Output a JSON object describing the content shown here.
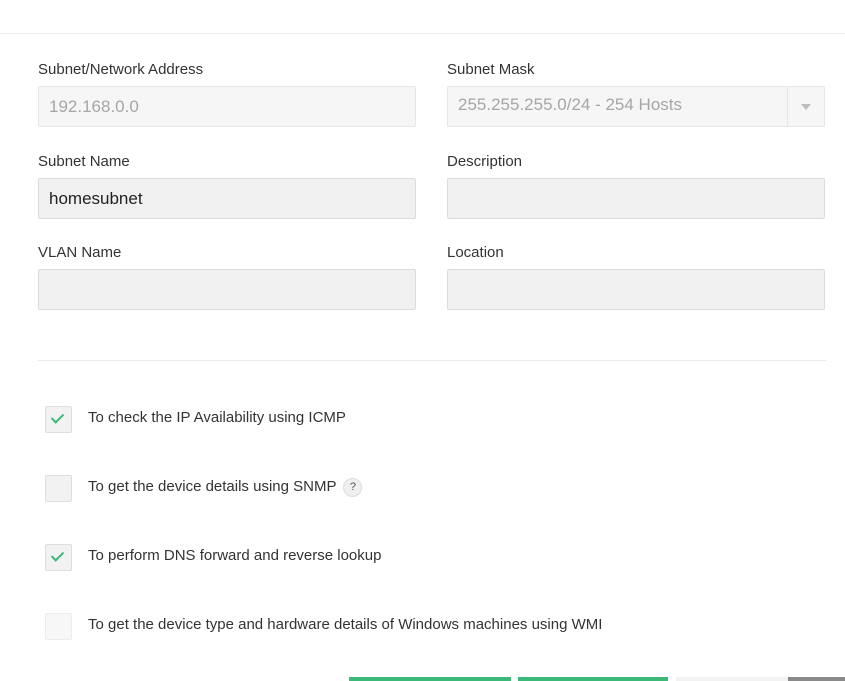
{
  "form": {
    "subnet_address": {
      "label": "Subnet/Network Address",
      "value": "192.168.0.0"
    },
    "subnet_mask": {
      "label": "Subnet Mask",
      "value": "255.255.255.0/24 - 254 Hosts"
    },
    "subnet_name": {
      "label": "Subnet Name",
      "value": "homesubnet"
    },
    "description": {
      "label": "Description",
      "value": ""
    },
    "vlan_name": {
      "label": "VLAN Name",
      "value": ""
    },
    "location": {
      "label": "Location",
      "value": ""
    }
  },
  "options": [
    {
      "label": "To check the IP Availability using ICMP",
      "checked": true
    },
    {
      "label": "To get the device details using SNMP",
      "checked": false,
      "help": "?"
    },
    {
      "label": "To perform DNS forward and reverse lookup",
      "checked": true
    },
    {
      "label": "To get the device type and hardware details of Windows machines using WMI",
      "checked": false
    }
  ],
  "colors": {
    "accent": "#3cb878",
    "field_bg": "#f0f0f0",
    "secondary_button": "#f2f2f2",
    "dark_button": "#8a8a8a"
  },
  "icons": {
    "dropdown": "chevron-down-icon",
    "check": "check-icon",
    "help": "help-icon"
  }
}
